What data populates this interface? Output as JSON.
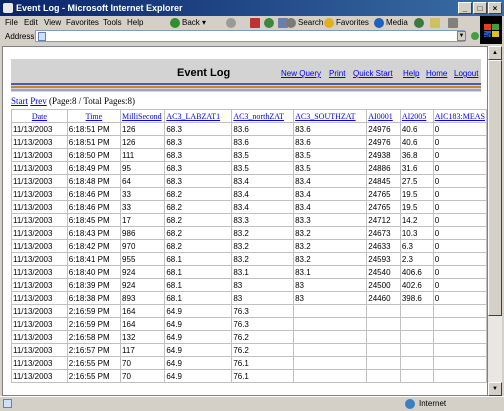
{
  "window": {
    "title": "Event Log - Microsoft Internet Explorer"
  },
  "menu": [
    "File",
    "Edit",
    "View",
    "Favorites",
    "Tools",
    "Help"
  ],
  "toolbar": {
    "back": "Back",
    "search": "Search",
    "favorites": "Favorites",
    "media": "Media"
  },
  "address": {
    "label": "Address",
    "value": "",
    "go": "Go"
  },
  "header": {
    "title": "Event Log",
    "links": [
      "New Query",
      "Print",
      "Quick Start",
      "Help",
      "Home",
      "Logout"
    ]
  },
  "nav": {
    "start": "Start",
    "prev": "Prev",
    "page_info": "(Page:8 / Total Pages:8)"
  },
  "table": {
    "columns": [
      "Date",
      "Time",
      "MilliSecond",
      "AC3_LABZAT1",
      "AC3_northZAT",
      "AC3_SOUTHZAT",
      "AI0001",
      "AI2005",
      "AIC183:MEAS"
    ],
    "rows": [
      [
        "11/13/2003",
        "6:18:51 PM",
        "126",
        "68.3",
        "83.6",
        "83.6",
        "24976",
        "40.6",
        "0"
      ],
      [
        "11/13/2003",
        "6:18:51 PM",
        "126",
        "68.3",
        "83.6",
        "83.6",
        "24976",
        "40.6",
        "0"
      ],
      [
        "11/13/2003",
        "6:18:50 PM",
        "111",
        "68.3",
        "83.5",
        "83.5",
        "24938",
        "36.8",
        "0"
      ],
      [
        "11/13/2003",
        "6:18:49 PM",
        "95",
        "68.3",
        "83.5",
        "83.5",
        "24886",
        "31.6",
        "0"
      ],
      [
        "11/13/2003",
        "6:18:48 PM",
        "64",
        "68.3",
        "83.4",
        "83.4",
        "24845",
        "27.5",
        "0"
      ],
      [
        "11/13/2003",
        "6:18:46 PM",
        "33",
        "68.2",
        "83.4",
        "83.4",
        "24765",
        "19.5",
        "0"
      ],
      [
        "11/13/2003",
        "6:18:46 PM",
        "33",
        "68.2",
        "83.4",
        "83.4",
        "24765",
        "19.5",
        "0"
      ],
      [
        "11/13/2003",
        "6:18:45 PM",
        "17",
        "68.2",
        "83.3",
        "83.3",
        "24712",
        "14.2",
        "0"
      ],
      [
        "11/13/2003",
        "6:18:43 PM",
        "986",
        "68.2",
        "83.2",
        "83.2",
        "24673",
        "10.3",
        "0"
      ],
      [
        "11/13/2003",
        "6:18:42 PM",
        "970",
        "68.2",
        "83.2",
        "83.2",
        "24633",
        "6.3",
        "0"
      ],
      [
        "11/13/2003",
        "6:18:41 PM",
        "955",
        "68.1",
        "83.2",
        "83.2",
        "24593",
        "2.3",
        "0"
      ],
      [
        "11/13/2003",
        "6:18:40 PM",
        "924",
        "68.1",
        "83.1",
        "83.1",
        "24540",
        "406.6",
        "0"
      ],
      [
        "11/13/2003",
        "6:18:39 PM",
        "924",
        "68.1",
        "83",
        "83",
        "24500",
        "402.6",
        "0"
      ],
      [
        "11/13/2003",
        "6:18:38 PM",
        "893",
        "68.1",
        "83",
        "83",
        "24460",
        "398.6",
        "0"
      ],
      [
        "11/13/2003",
        "2:16:59 PM",
        "164",
        "64.9",
        "76.3",
        "",
        "",
        "",
        ""
      ],
      [
        "11/13/2003",
        "2:16:59 PM",
        "164",
        "64.9",
        "76.3",
        "",
        "",
        "",
        ""
      ],
      [
        "11/13/2003",
        "2:16:58 PM",
        "132",
        "64.9",
        "76.2",
        "",
        "",
        "",
        ""
      ],
      [
        "11/13/2003",
        "2:16:57 PM",
        "117",
        "64.9",
        "76.2",
        "",
        "",
        "",
        ""
      ],
      [
        "11/13/2003",
        "2:16:55 PM",
        "70",
        "64.9",
        "76.1",
        "",
        "",
        "",
        ""
      ],
      [
        "11/13/2003",
        "2:16:55 PM",
        "70",
        "64.9",
        "76.1",
        "",
        "",
        "",
        ""
      ]
    ]
  },
  "status": {
    "zone": "Internet"
  }
}
